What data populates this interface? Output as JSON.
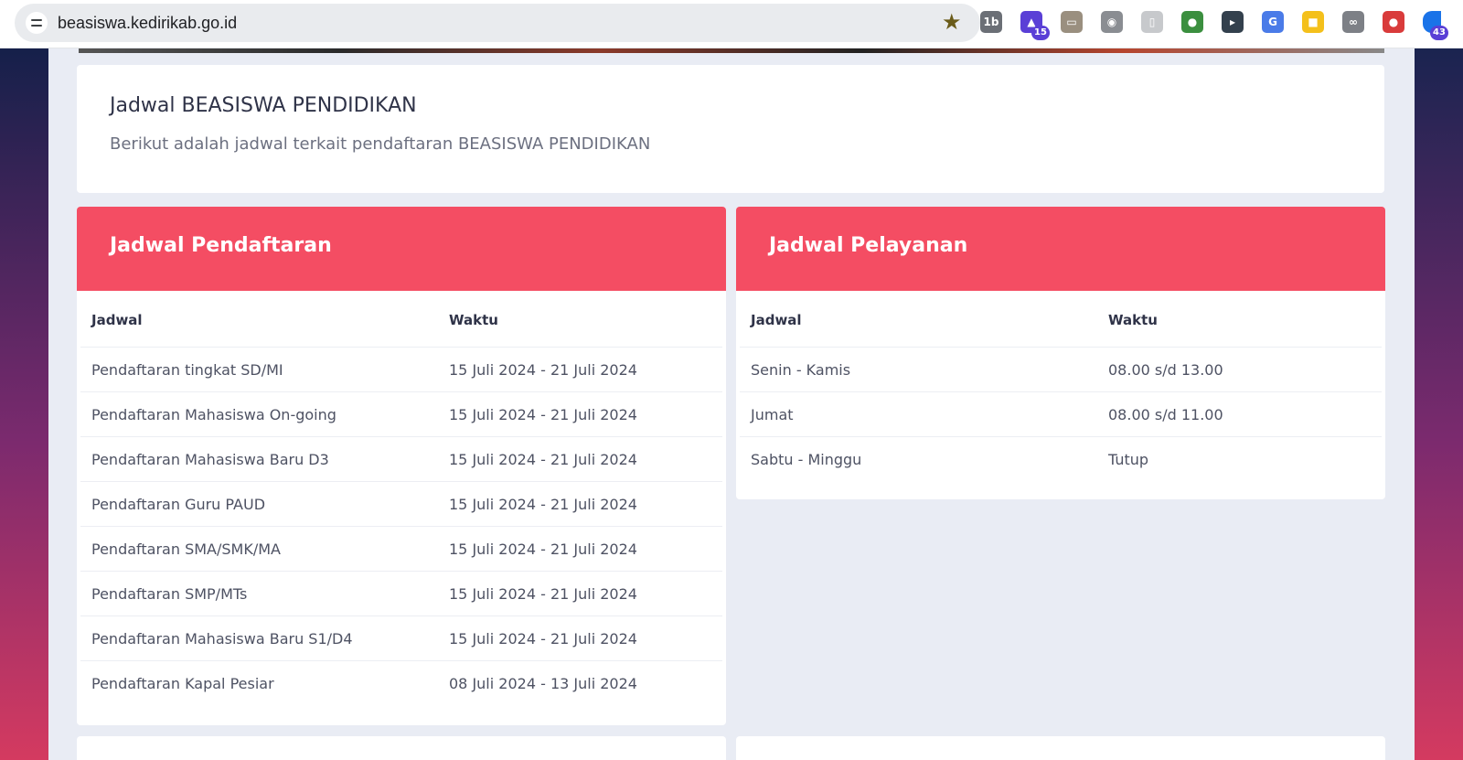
{
  "browser": {
    "url": "beasiswa.kedirikab.go.id",
    "extensions": [
      {
        "name": "1b-extension-icon",
        "label": "1b",
        "color": "#6b6f76"
      },
      {
        "name": "graduation-cap-extension-icon",
        "label": "▲",
        "color": "#5a3fd6",
        "badge": "15"
      },
      {
        "name": "window-extension-icon",
        "label": "▭",
        "color": "#9a8f7f"
      },
      {
        "name": "camera-extension-icon",
        "label": "◉",
        "color": "#8a8d92"
      },
      {
        "name": "page-extension-icon",
        "label": "▯",
        "color": "#c7c9cc"
      },
      {
        "name": "globe-extension-icon",
        "label": "●",
        "color": "#3b8f3f"
      },
      {
        "name": "cursor-extension-icon",
        "label": "▸",
        "color": "#33404d"
      },
      {
        "name": "translate-extension-icon",
        "label": "G",
        "color": "#4a7be8"
      },
      {
        "name": "keep-extension-icon",
        "label": "■",
        "color": "#f4c01b"
      },
      {
        "name": "link-extension-icon",
        "label": "∞",
        "color": "#7d8086"
      },
      {
        "name": "pokeball-extension-icon",
        "label": "●",
        "color": "#d93b3b"
      },
      {
        "name": "extensions-badge-icon",
        "label": "",
        "color": "#1a73e8",
        "badge": "43"
      }
    ]
  },
  "intro": {
    "title": "Jadwal BEASISWA PENDIDIKAN",
    "subtitle": "Berikut adalah jadwal terkait pendaftaran BEASISWA PENDIDIKAN"
  },
  "pendaftaran": {
    "title": "Jadwal Pendaftaran",
    "col_jadwal": "Jadwal",
    "col_waktu": "Waktu",
    "rows": [
      {
        "jadwal": "Pendaftaran tingkat SD/MI",
        "waktu": "15 Juli 2024 - 21 Juli 2024"
      },
      {
        "jadwal": "Pendaftaran Mahasiswa On-going",
        "waktu": "15 Juli 2024 - 21 Juli 2024"
      },
      {
        "jadwal": "Pendaftaran Mahasiswa Baru D3",
        "waktu": "15 Juli 2024 - 21 Juli 2024"
      },
      {
        "jadwal": "Pendaftaran Guru PAUD",
        "waktu": "15 Juli 2024 - 21 Juli 2024"
      },
      {
        "jadwal": "Pendaftaran SMA/SMK/MA",
        "waktu": "15 Juli 2024 - 21 Juli 2024"
      },
      {
        "jadwal": "Pendaftaran SMP/MTs",
        "waktu": "15 Juli 2024 - 21 Juli 2024"
      },
      {
        "jadwal": "Pendaftaran Mahasiswa Baru S1/D4",
        "waktu": "15 Juli 2024 - 21 Juli 2024"
      },
      {
        "jadwal": "Pendaftaran Kapal Pesiar",
        "waktu": "08 Juli 2024 - 13 Juli 2024"
      }
    ]
  },
  "pelayanan": {
    "title": "Jadwal Pelayanan",
    "col_jadwal": "Jadwal",
    "col_waktu": "Waktu",
    "rows": [
      {
        "jadwal": "Senin - Kamis",
        "waktu": "08.00 s/d 13.00"
      },
      {
        "jadwal": "Jumat",
        "waktu": "08.00 s/d 11.00"
      },
      {
        "jadwal": "Sabtu - Minggu",
        "waktu": "Tutup"
      }
    ]
  },
  "colors": {
    "accent": "#f44d63",
    "background": "#e9ecf4"
  }
}
